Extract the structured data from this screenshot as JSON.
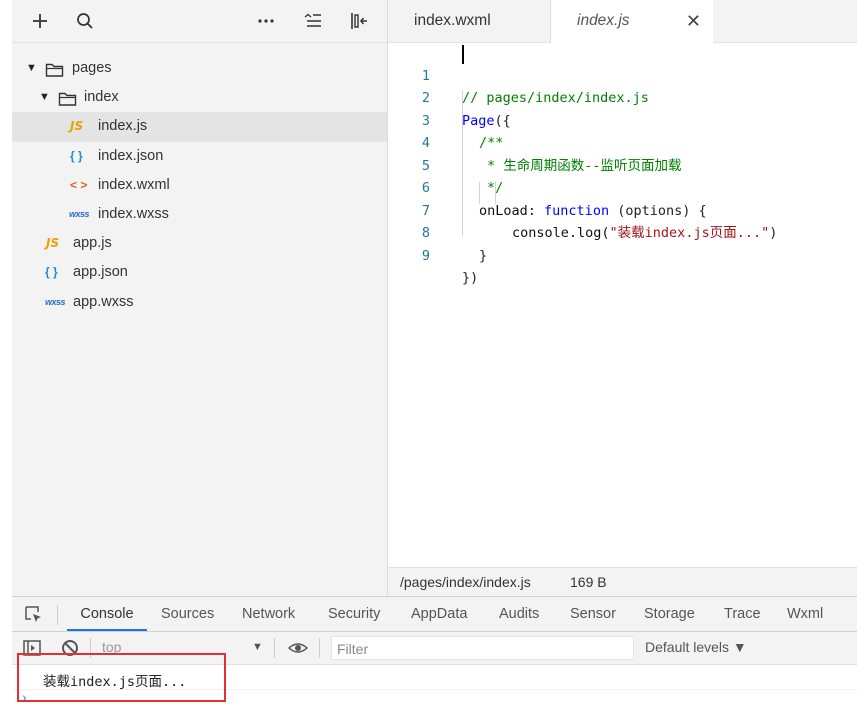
{
  "explorer": {
    "tree": [
      {
        "label": "pages",
        "level": 0,
        "type": "folder",
        "expanded": true,
        "icon": "folder-icon"
      },
      {
        "label": "index",
        "level": 1,
        "type": "folder",
        "expanded": true,
        "icon": "folder-icon"
      },
      {
        "label": "index.js",
        "level": 2,
        "type": "js",
        "icon_text": "JS",
        "selected": true
      },
      {
        "label": "index.json",
        "level": 2,
        "type": "json",
        "icon_text": "{ }"
      },
      {
        "label": "index.wxml",
        "level": 2,
        "type": "wxml",
        "icon_text": "< >"
      },
      {
        "label": "index.wxss",
        "level": 2,
        "type": "wxss",
        "icon_text": "wxss"
      },
      {
        "label": "app.js",
        "level": 1,
        "type": "js",
        "icon_text": "JS"
      },
      {
        "label": "app.json",
        "level": 1,
        "type": "json",
        "icon_text": "{ }"
      },
      {
        "label": "app.wxss",
        "level": 1,
        "type": "wxss",
        "icon_text": "wxss"
      }
    ]
  },
  "editor": {
    "tabs": [
      {
        "label": "index.wxml",
        "active": false
      },
      {
        "label": "index.js",
        "active": true,
        "close": "✕"
      }
    ],
    "line_numbers": [
      "1",
      "2",
      "3",
      "4",
      "5",
      "6",
      "7",
      "8",
      "9"
    ],
    "code": {
      "l1": "// pages/index/index.js",
      "l2a": "Page",
      "l2b": "({",
      "l3": "/**",
      "l4": "* 生命周期函数--监听页面加载",
      "l5": "*/",
      "l6a": "onLoad",
      "l6b": ": ",
      "l6c": "function",
      "l6d": " (options) {",
      "l7a": "console.log(",
      "l7b": "\"装载index.js页面...\"",
      "l7c": ")",
      "l8": "}",
      "l9": "})"
    },
    "status": {
      "path": "/pages/index/index.js",
      "size": "169 B"
    }
  },
  "devtools": {
    "tabs": [
      "Console",
      "Sources",
      "Network",
      "Security",
      "AppData",
      "Audits",
      "Sensor",
      "Storage",
      "Trace",
      "Wxml"
    ],
    "context": "top",
    "filter_placeholder": "Filter",
    "levels": "Default levels ▼",
    "log": "装载index.js页面...",
    "prompt": "›"
  },
  "colors": {
    "accent": "#1a73e8",
    "highlight": "#e03131",
    "comment": "#008000",
    "keyword": "#0000ff",
    "string": "#a31515"
  }
}
